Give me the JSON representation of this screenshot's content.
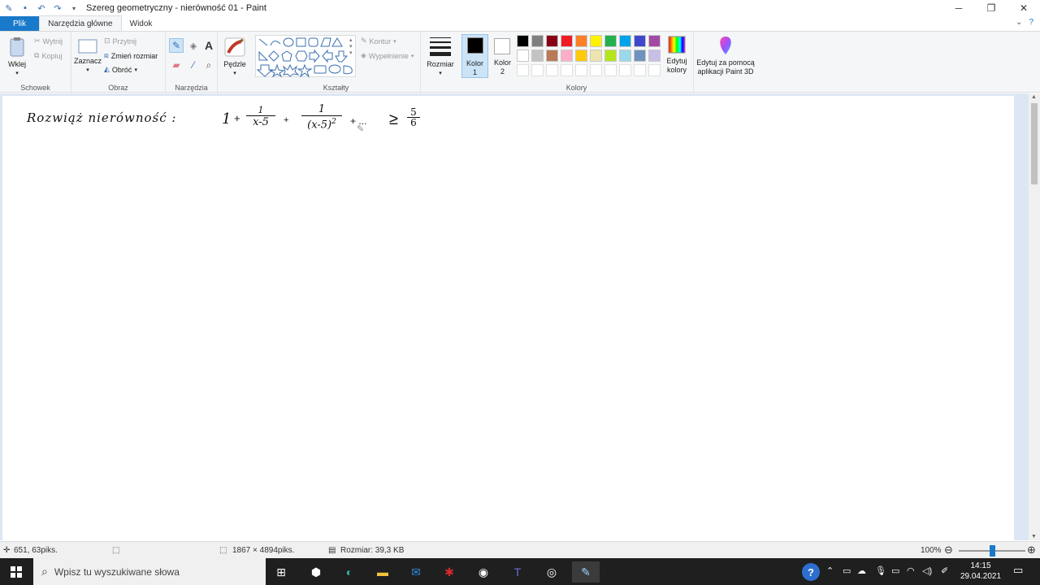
{
  "window": {
    "title": "Szereg geometryczny - nierówność 01 - Paint"
  },
  "tabs": {
    "file": "Plik",
    "home": "Narzędzia główne",
    "view": "Widok"
  },
  "clipboard": {
    "paste": "Wklej",
    "cut": "Wytnij",
    "copy": "Kopiuj",
    "label": "Schowek"
  },
  "image": {
    "select": "Zaznacz",
    "crop": "Przytnij",
    "resize": "Zmień rozmiar",
    "rotate": "Obróć",
    "label": "Obraz"
  },
  "tools": {
    "label": "Narzędzia"
  },
  "brushes": {
    "label": "Pędzle"
  },
  "shapes": {
    "outline": "Kontur",
    "fill": "Wypełnienie",
    "label": "Kształty"
  },
  "size": {
    "label": "Rozmiar"
  },
  "colors": {
    "color1_l1": "Kolor",
    "color1_l2": "1",
    "color2_l1": "Kolor",
    "color2_l2": "2",
    "edit_l1": "Edytuj",
    "edit_l2": "kolory",
    "label": "Kolory",
    "row1": [
      "#000000",
      "#7f7f7f",
      "#880015",
      "#ed1c24",
      "#ff7f27",
      "#fff200",
      "#22b14c",
      "#00a2e8",
      "#3f48cc",
      "#a349a4"
    ],
    "row2": [
      "#ffffff",
      "#c3c3c3",
      "#b97a57",
      "#ffaec9",
      "#ffc90e",
      "#efe4b0",
      "#b5e61d",
      "#99d9ea",
      "#7092be",
      "#c8bfe7"
    ],
    "color1": "#000000",
    "color2": "#ffffff"
  },
  "paint3d": {
    "l1": "Edytuj za pomocą",
    "l2": "aplikacji Paint 3D"
  },
  "canvas": {
    "handwriting": {
      "label": "Rozwiąż nierówność :",
      "one": "1",
      "plus1": "+",
      "frac1_num": "1",
      "frac1_den": "x-5",
      "plus2": "+",
      "frac2_num": "1",
      "frac2_den": "(x-5)",
      "frac2_exp": "2",
      "tail": "+ ...",
      "geq": "≥",
      "rhs_num": "5",
      "rhs_den": "6"
    }
  },
  "status": {
    "cursor": "651, 63piks.",
    "dimensions": "1867 × 4894piks.",
    "size": "Rozmiar: 39,3 KB",
    "zoom": "100%",
    "zoom_level": 0.5
  },
  "taskbar": {
    "search_placeholder": "Wpisz tu wyszukiwane słowa",
    "time": "14:15",
    "date": "29.04.2021"
  }
}
